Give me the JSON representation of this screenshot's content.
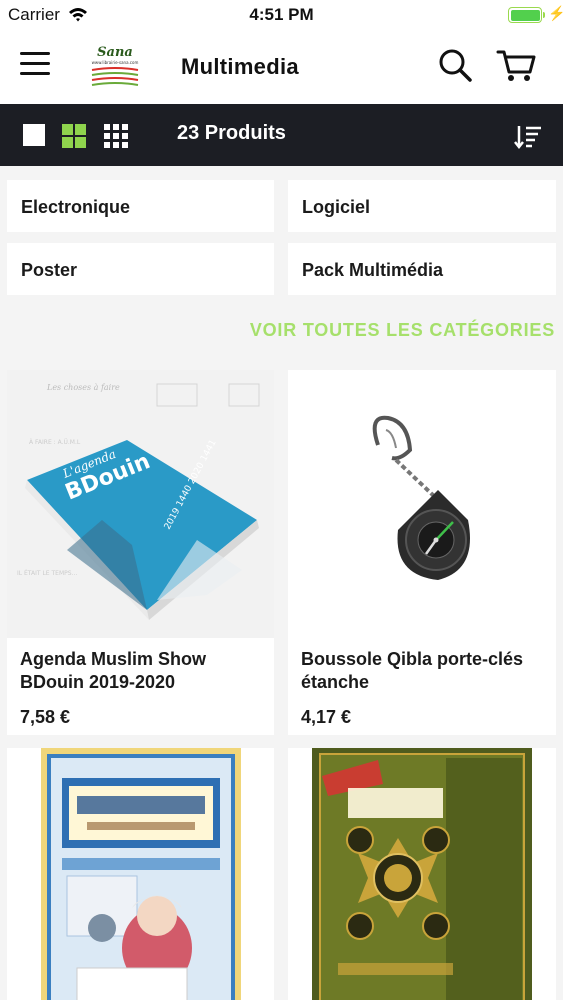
{
  "status_bar": {
    "carrier": "Carrier",
    "time": "4:51 PM",
    "battery_level": 1.0
  },
  "navbar": {
    "title": "Multimedia",
    "logo_text": "Sana",
    "logo_subtext": "www.librairie-sana.com"
  },
  "toolbar": {
    "product_count": "23 Produits"
  },
  "categories": [
    "Electronique",
    "Logiciel",
    "Poster",
    "Pack Multimédia"
  ],
  "all_categories_link": "VOIR TOUTES LES CATÉGORIES",
  "products": [
    {
      "name": "Agenda Muslim Show BDouin 2019-2020",
      "price": "7,58 €",
      "cover_title": "BDouin",
      "cover_subtitle": "L'agenda",
      "cover_years": "2019 1440 2020 1441"
    },
    {
      "name": "Boussole Qibla porte-clés étanche",
      "price": "4,17 €"
    },
    {
      "name": "",
      "price": ""
    },
    {
      "name": "",
      "price": ""
    }
  ],
  "colors": {
    "accent": "#8fd44d",
    "toolbar_bg": "#1c1e24",
    "page_bg": "#f4f4f4"
  }
}
